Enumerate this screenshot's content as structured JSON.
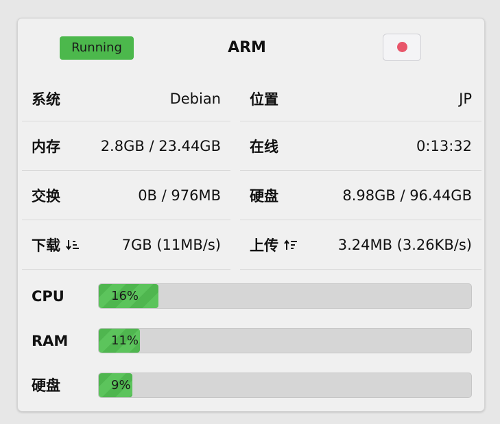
{
  "header": {
    "status": "Running",
    "title": "ARM",
    "status_color": "#4cb84c",
    "record_button_color": "#e8556a"
  },
  "info": [
    {
      "label": "系统",
      "value": "Debian"
    },
    {
      "label": "位置",
      "value": "JP"
    },
    {
      "label": "内存",
      "value": "2.8GB / 23.44GB"
    },
    {
      "label": "在线",
      "value": "0:13:32"
    },
    {
      "label": "交换",
      "value": "0B / 976MB"
    },
    {
      "label": "硬盘",
      "value": "8.98GB / 96.44GB"
    },
    {
      "label": "下载",
      "value": "7GB (11MB/s)",
      "icon": "sort-down-icon"
    },
    {
      "label": "上传",
      "value": "3.24MB (3.26KB/s)",
      "icon": "sort-up-icon"
    }
  ],
  "meters": [
    {
      "label": "CPU",
      "text": "16%",
      "percent": 16
    },
    {
      "label": "RAM",
      "text": "11%",
      "percent": 11
    },
    {
      "label": "硬盘",
      "text": "9%",
      "percent": 9
    }
  ],
  "colors": {
    "bar_fill": "#4fb64f",
    "bar_track": "#d6d6d6"
  }
}
